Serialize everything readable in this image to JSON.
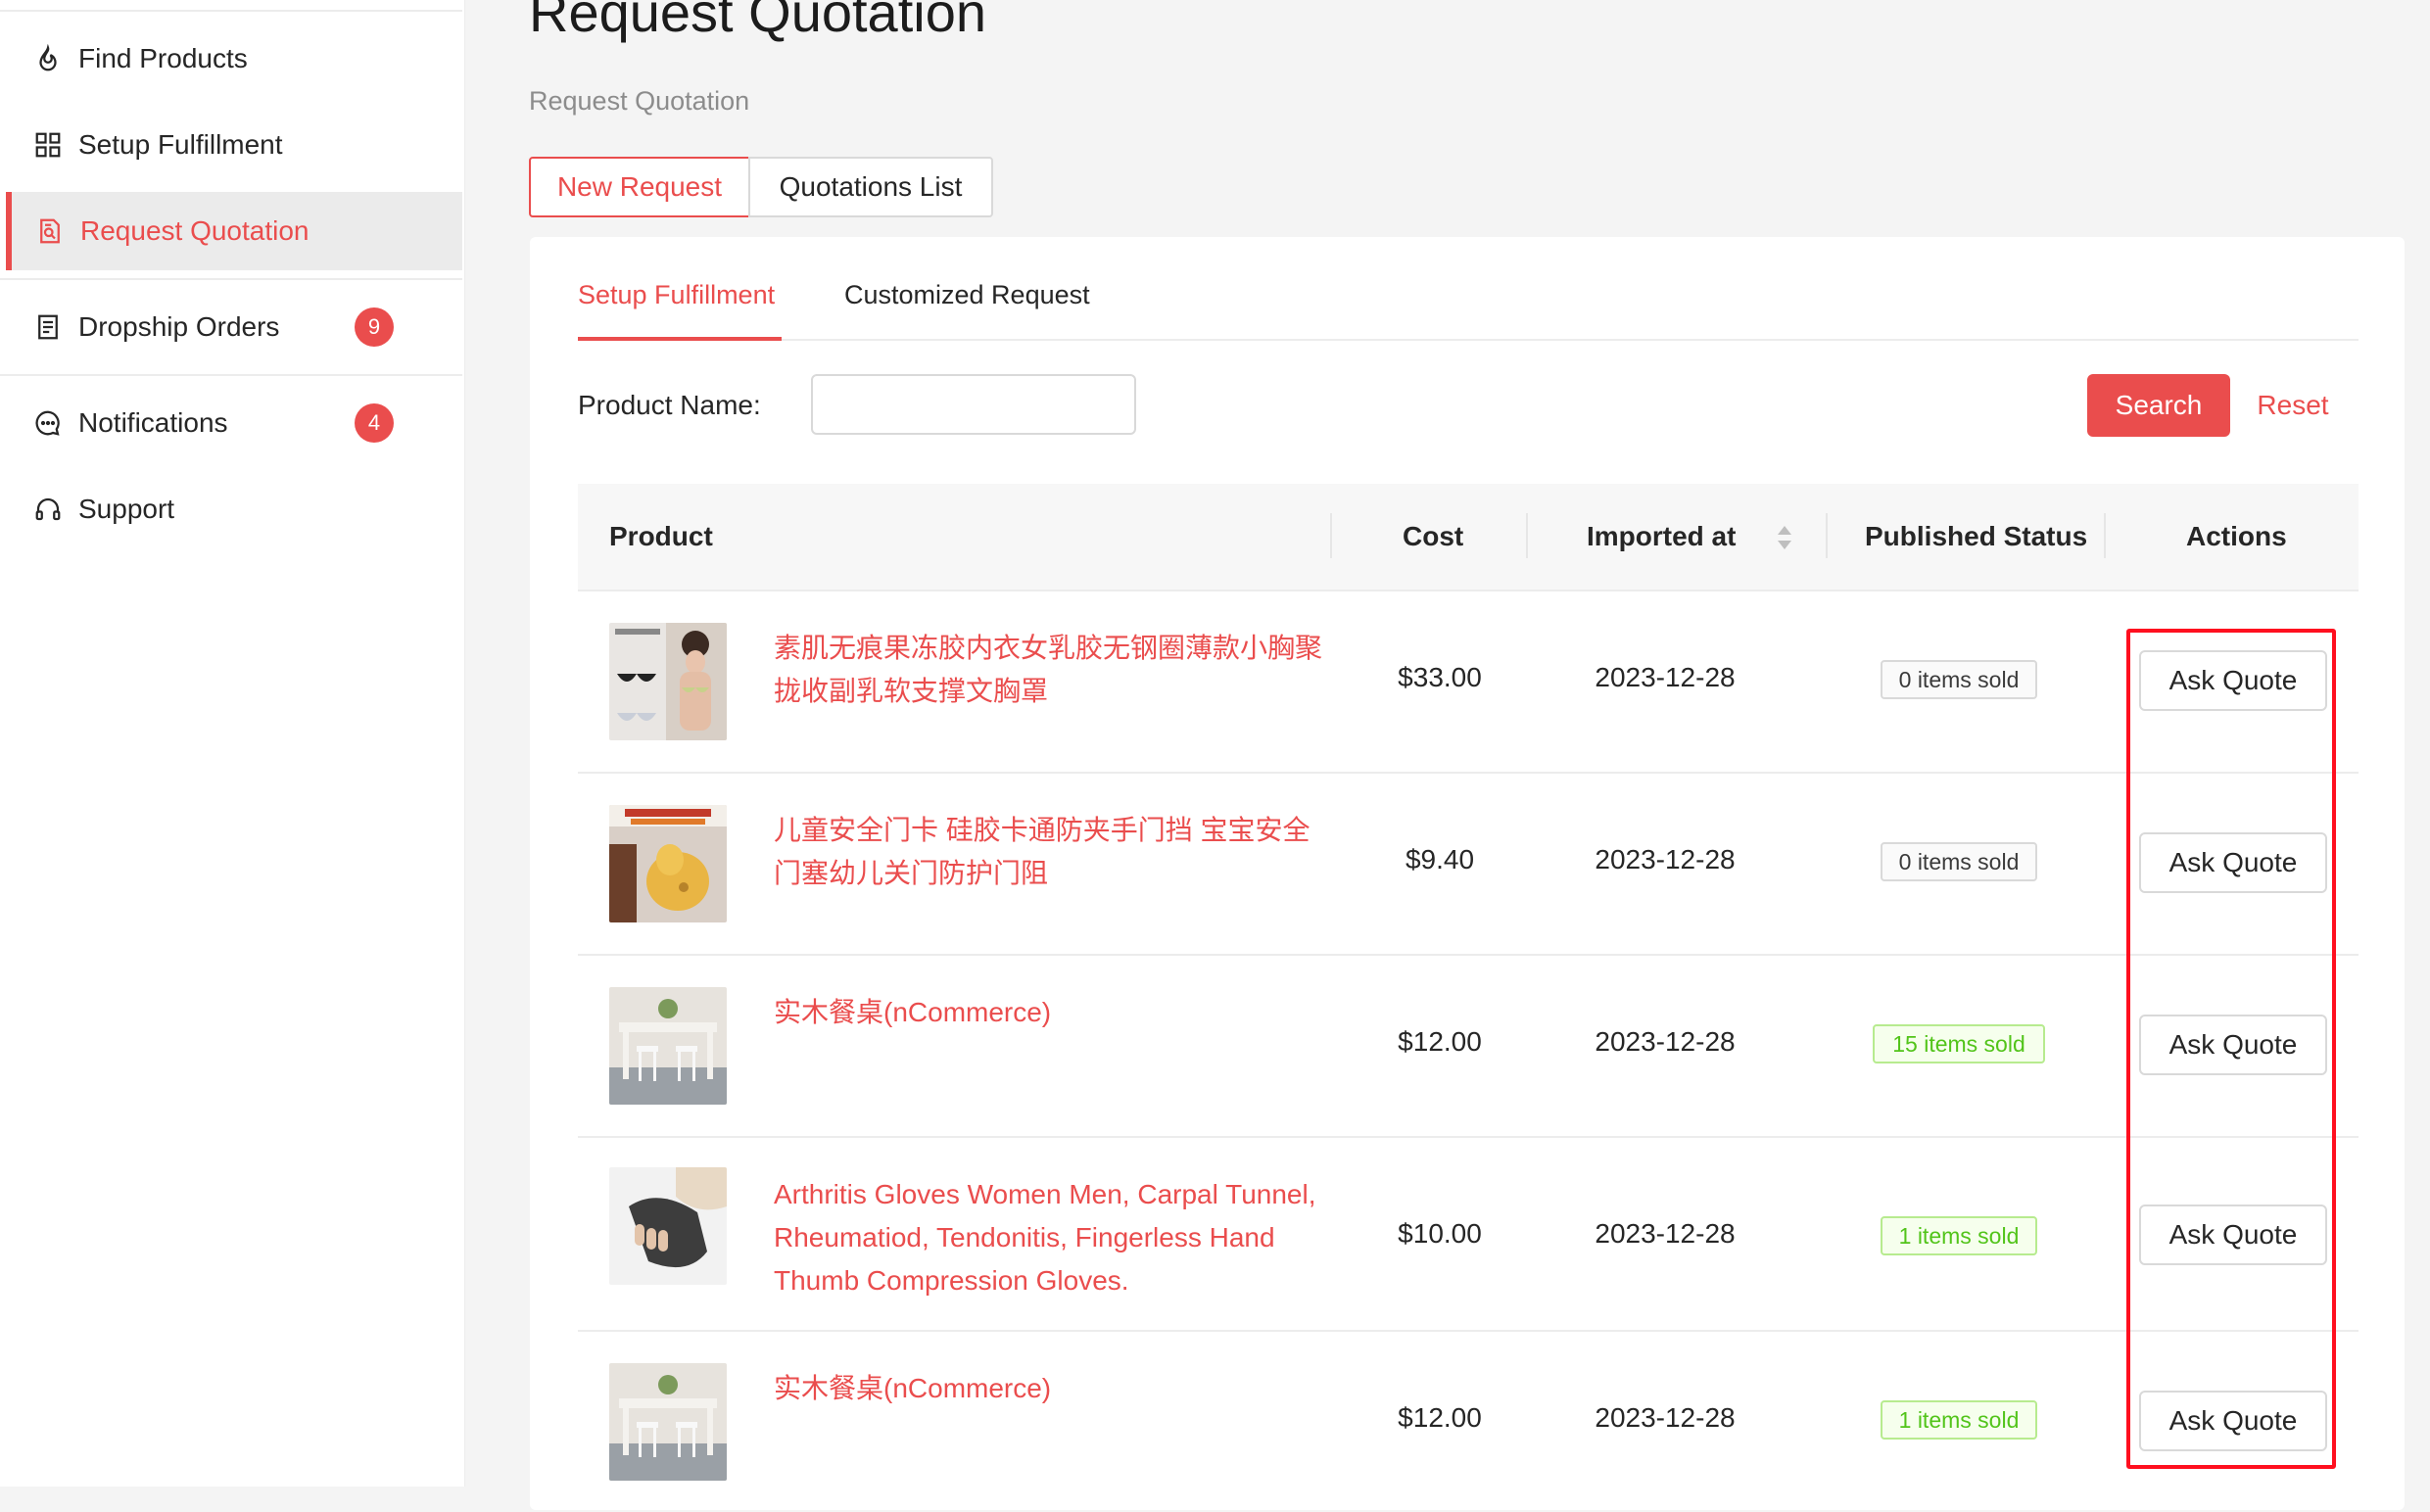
{
  "sidebar": {
    "items": [
      {
        "label": "Find Products",
        "icon": "flame-icon"
      },
      {
        "label": "Setup Fulfillment",
        "icon": "grid-icon"
      },
      {
        "label": "Request Quotation",
        "icon": "quote-doc-icon"
      },
      {
        "label": "Dropship Orders",
        "icon": "orders-doc-icon",
        "badge": "9"
      },
      {
        "label": "Notifications",
        "icon": "chat-bubble-icon",
        "badge": "4"
      },
      {
        "label": "Support",
        "icon": "headset-icon"
      }
    ]
  },
  "page": {
    "title": "Request Quotation",
    "breadcrumb": "Request Quotation"
  },
  "tabs": {
    "new_request": "New Request",
    "quotations_list": "Quotations List"
  },
  "subtabs": {
    "setup_fulfillment": "Setup Fulfillment",
    "customized_request": "Customized Request"
  },
  "filter": {
    "label": "Product Name:",
    "value": "",
    "placeholder": "",
    "search_label": "Search",
    "reset_label": "Reset"
  },
  "table": {
    "headers": {
      "product": "Product",
      "cost": "Cost",
      "imported_at": "Imported at",
      "published_status": "Published Status",
      "actions": "Actions"
    },
    "action_label": "Ask Quote",
    "rows": [
      {
        "name": "素肌无痕果冻胶内衣女乳胶无钢圈薄款小胸聚拢收副乳软支撑文胸罩",
        "cost": "$33.00",
        "imported": "2023-12-28",
        "status": "0 items sold",
        "status_type": "grey",
        "thumb": "bra-product-photo"
      },
      {
        "name": "儿童安全门卡 硅胶卡通防夹手门挡 宝宝安全门塞幼儿关门防护门阻",
        "cost": "$9.40",
        "imported": "2023-12-28",
        "status": "0 items sold",
        "status_type": "grey",
        "thumb": "door-stopper-product-photo"
      },
      {
        "name": "实木餐桌(nCommerce)",
        "cost": "$12.00",
        "imported": "2023-12-28",
        "status": "15 items sold",
        "status_type": "green",
        "thumb": "dining-table-product-photo"
      },
      {
        "name": "Arthritis Gloves Women Men, Carpal Tunnel, Rheumatiod, Tendonitis, Fingerless Hand Thumb Compression Gloves.",
        "cost": "$10.00",
        "imported": "2023-12-28",
        "status": "1 items sold",
        "status_type": "green",
        "thumb": "gloves-product-photo"
      },
      {
        "name": "实木餐桌(nCommerce)",
        "cost": "$12.00",
        "imported": "2023-12-28",
        "status": "1 items sold",
        "status_type": "green",
        "thumb": "dining-table-product-photo"
      }
    ]
  },
  "colors": {
    "accent": "#ea4d4d",
    "highlight_box": "#ff0f1f",
    "tag_green": "#52c41a"
  }
}
